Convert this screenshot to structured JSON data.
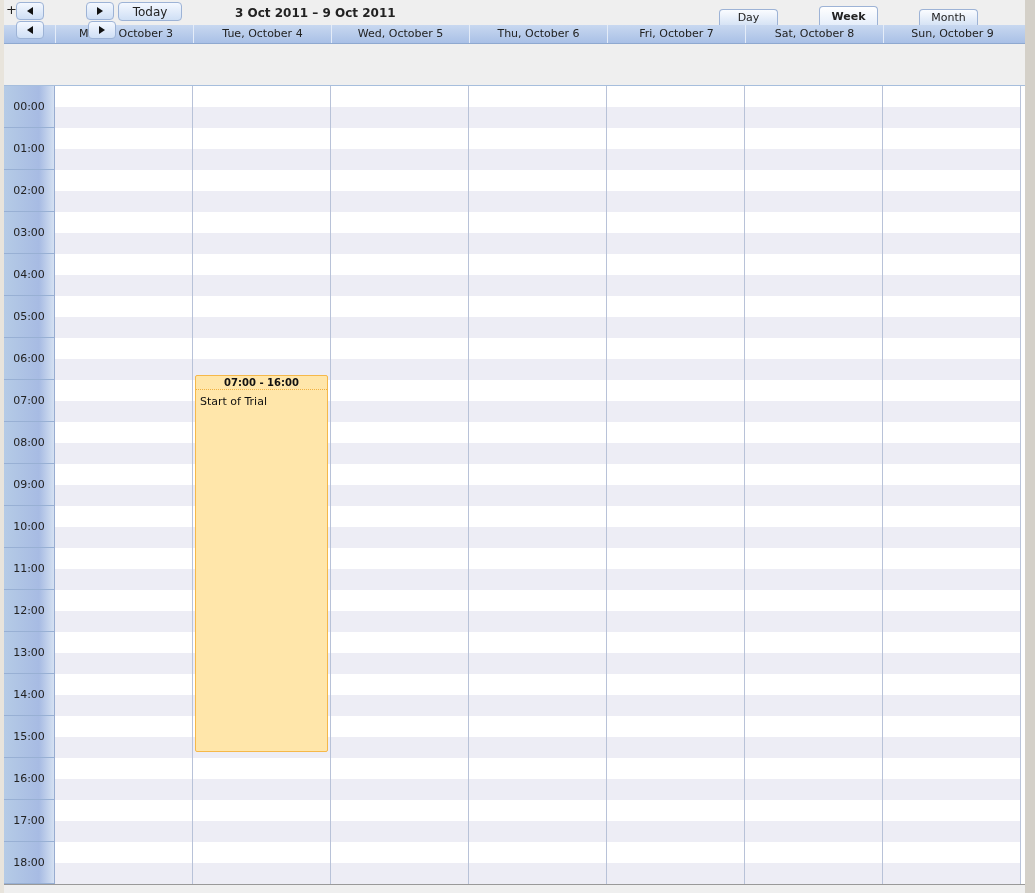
{
  "toolbar": {
    "expand": "+",
    "range": "3 Oct 2011 – 9 Oct 2011",
    "today": "Today"
  },
  "views": [
    {
      "label": "Day",
      "selected": false
    },
    {
      "label": "Week",
      "selected": true
    },
    {
      "label": "Month",
      "selected": false
    }
  ],
  "days": [
    {
      "fragments": [
        "M",
        "October 3"
      ]
    },
    {
      "label": "Tue, October 4",
      "events": [
        {
          "time": "07:00 - 16:00",
          "title": "Start of Trial"
        }
      ]
    },
    {
      "label": "Wed, October 5"
    },
    {
      "label": "Thu, October 6"
    },
    {
      "label": "Fri, October 7"
    },
    {
      "label": "Sat, October 8"
    },
    {
      "label": "Sun, October 9"
    }
  ],
  "hours": [
    "00:00",
    "01:00",
    "02:00",
    "03:00",
    "04:00",
    "05:00",
    "06:00",
    "07:00",
    "08:00",
    "09:00",
    "10:00",
    "11:00",
    "12:00",
    "13:00",
    "14:00",
    "15:00",
    "16:00",
    "17:00",
    "18:00"
  ]
}
